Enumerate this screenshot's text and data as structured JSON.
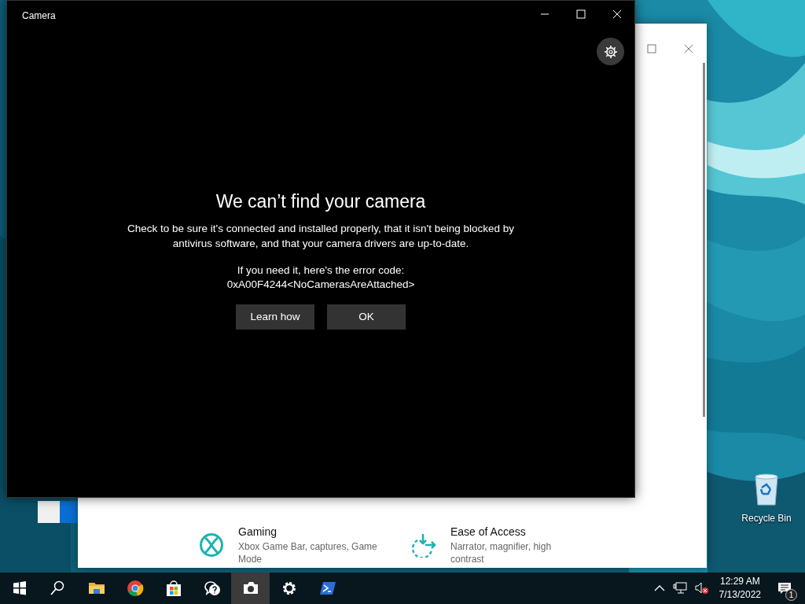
{
  "desktop": {
    "icons": [
      {
        "label": "Recycle Bin",
        "kind": "recycle"
      }
    ]
  },
  "settings_window": {
    "tiles": [
      {
        "kind": "gaming",
        "title": "Gaming",
        "description": "Xbox Game Bar, captures, Game Mode"
      },
      {
        "kind": "access",
        "title": "Ease of Access",
        "description": "Narrator, magnifier, high contrast"
      }
    ]
  },
  "camera_window": {
    "title": "Camera",
    "heading": "We can’t find your camera",
    "message": "Check to be sure it's connected and installed properly, that it isn't being blocked by antivirus software, and that your camera drivers are up-to-date.",
    "code_label": "If you need it, here's the error code:",
    "code": "0xA00F4244<NoCamerasAreAttached>",
    "buttons": [
      "Learn how",
      "OK"
    ]
  },
  "taskbar": {
    "apps": [
      {
        "kind": "start",
        "selected": false
      },
      {
        "kind": "search",
        "selected": false
      },
      {
        "kind": "folder",
        "selected": false
      },
      {
        "kind": "browser",
        "selected": false
      },
      {
        "kind": "store",
        "selected": false
      },
      {
        "kind": "help",
        "selected": false
      },
      {
        "kind": "camera",
        "selected": true
      },
      {
        "kind": "settings",
        "selected": false
      },
      {
        "kind": "terminal",
        "selected": false
      }
    ],
    "clock": {
      "time": "12:29 AM",
      "date": "7/13/2022"
    },
    "notification_count": "1"
  }
}
